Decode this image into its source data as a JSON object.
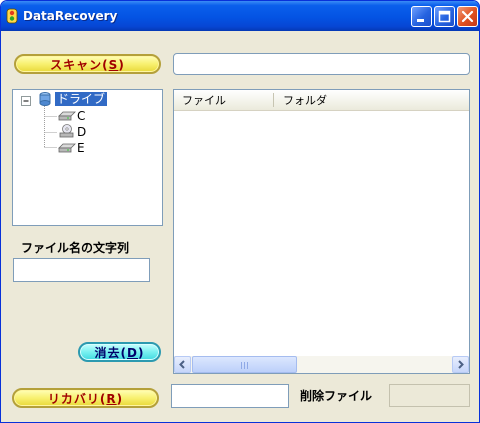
{
  "window": {
    "title": "DataRecovery"
  },
  "buttons": {
    "scan": {
      "text": "スキャン(",
      "key": "S",
      "close": ")"
    },
    "clear": {
      "text": "消去(",
      "key": "D",
      "close": ")"
    },
    "recover": {
      "text": "リカバリ(",
      "key": "R",
      "close": ")"
    }
  },
  "scan_path_input": {
    "value": ""
  },
  "tree": {
    "root": {
      "label": "ドライブ",
      "expander": "⊟"
    },
    "items": [
      {
        "label": "C"
      },
      {
        "label": "D"
      },
      {
        "label": "E"
      }
    ]
  },
  "filename_filter": {
    "label": "ファイル名の文字列",
    "value": ""
  },
  "file_list": {
    "columns": [
      "ファイル",
      "フォルダ"
    ],
    "rows": [],
    "scroll_grip": "III"
  },
  "recover_target_input": {
    "value": ""
  },
  "deleted_files": {
    "label": "削除ファイル",
    "value": ""
  },
  "colors": {
    "titlebar": "#0453E3",
    "button_text": "#A00000",
    "accent": "#40D8E0"
  }
}
